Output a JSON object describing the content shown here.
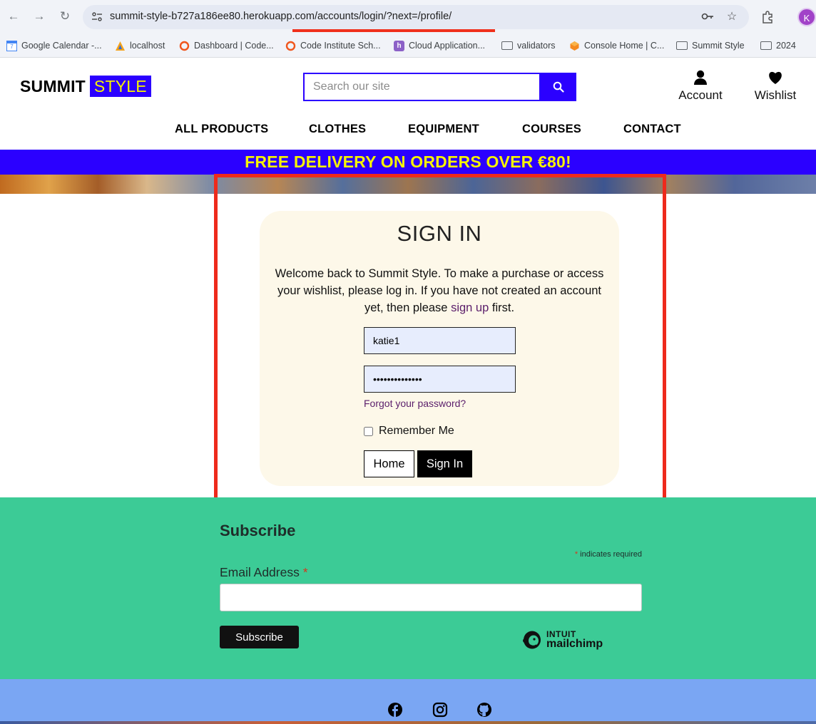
{
  "browser": {
    "url": "summit-style-b727a186ee80.herokuapp.com/accounts/login/?next=/profile/",
    "profile_initial": "K",
    "bookmarks": [
      {
        "label": "Google Calendar -...",
        "icon": "google-calendar-icon"
      },
      {
        "label": "localhost",
        "icon": "localhost-icon"
      },
      {
        "label": "Dashboard | Code...",
        "icon": "code-institute-icon"
      },
      {
        "label": "Code Institute Sch...",
        "icon": "code-institute-icon"
      },
      {
        "label": "Cloud Application...",
        "icon": "heroku-icon"
      },
      {
        "label": "validators",
        "icon": "folder-icon"
      },
      {
        "label": "Console Home | C...",
        "icon": "aws-icon"
      },
      {
        "label": "Summit Style",
        "icon": "folder-icon"
      },
      {
        "label": "2024",
        "icon": "folder-icon"
      }
    ]
  },
  "header": {
    "logo_part1": "SUMMIT",
    "logo_part2": "STYLE",
    "search_placeholder": "Search our site",
    "account_label": "Account",
    "wishlist_label": "Wishlist"
  },
  "nav": {
    "items": [
      "ALL PRODUCTS",
      "CLOTHES",
      "EQUIPMENT",
      "COURSES",
      "CONTACT"
    ]
  },
  "banner": {
    "text": "FREE DELIVERY ON ORDERS OVER €80!"
  },
  "signin": {
    "title": "SIGN IN",
    "text_before": "Welcome back to Summit Style. To make a purchase or access your wishlist, please log in. If you have not created an account yet, then please ",
    "signup_link": "sign up",
    "text_after": " first.",
    "username_value": "katie1",
    "password_value": "••••••••••••••",
    "forgot_label": "Forgot your password?",
    "remember_label": "Remember Me",
    "home_button": "Home",
    "signin_button": "Sign In"
  },
  "subscribe": {
    "title": "Subscribe",
    "required_star": "*",
    "required_note": " indicates required",
    "email_label": "Email Address",
    "email_star": "*",
    "button": "Subscribe",
    "brand_line1": "INTUIT",
    "brand_line2": "mailchimp"
  },
  "colors": {
    "brand_blue": "#2b00ff",
    "brand_yellow": "#f6f400",
    "card_bg": "#fdf8e9",
    "subscribe_bg": "#3ccb96",
    "footer_bg": "#7aa6f3",
    "annotation_red": "#ee2a1c"
  },
  "footer": {
    "social": [
      "facebook-icon",
      "instagram-icon",
      "github-icon"
    ]
  }
}
